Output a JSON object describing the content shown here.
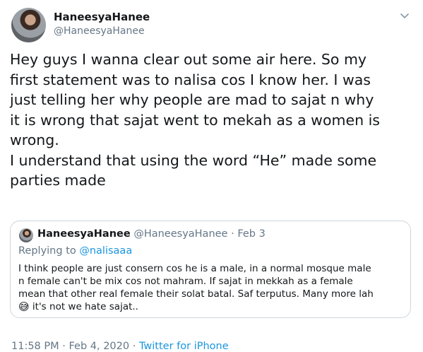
{
  "author": {
    "display_name": "HaneesyaHanee",
    "handle": "@HaneesyaHanee"
  },
  "tweet": {
    "text": "Hey guys I wanna clear out some air here. So my\nfirst statement was to nalisa cos I know her. I was\njust telling her why people are mad to sajat n why\nit is wrong that sajat went to mekah as a women is\nwrong.\nI understand that using the word “He” made some\nparties made"
  },
  "quoted_tweet": {
    "display_name": "HaneesyaHanee",
    "handle": "@HaneesyaHanee",
    "separator": "·",
    "date": "Feb 3",
    "replying_prefix": "Replying to",
    "replying_to": "@nalisaaa",
    "text": "I think people are just consern cos he is a male, in a normal mosque male\nn female can't be mix cos not mahram. If sajat in mekkah as a female\nmean that other real female their solat batal. Saf terputus. Many more lah\n",
    "emoji": "😅",
    "text_end": " it's not we hate sajat.."
  },
  "footer": {
    "time": "11:58 PM",
    "separator": "·",
    "date": "Feb 4, 2020",
    "source": "Twitter for iPhone"
  },
  "icons": {
    "more": "chevron-down-icon"
  },
  "colors": {
    "text": "#14171a",
    "secondary": "#657786",
    "link": "#1b95e0",
    "border": "#ccd6dd"
  }
}
